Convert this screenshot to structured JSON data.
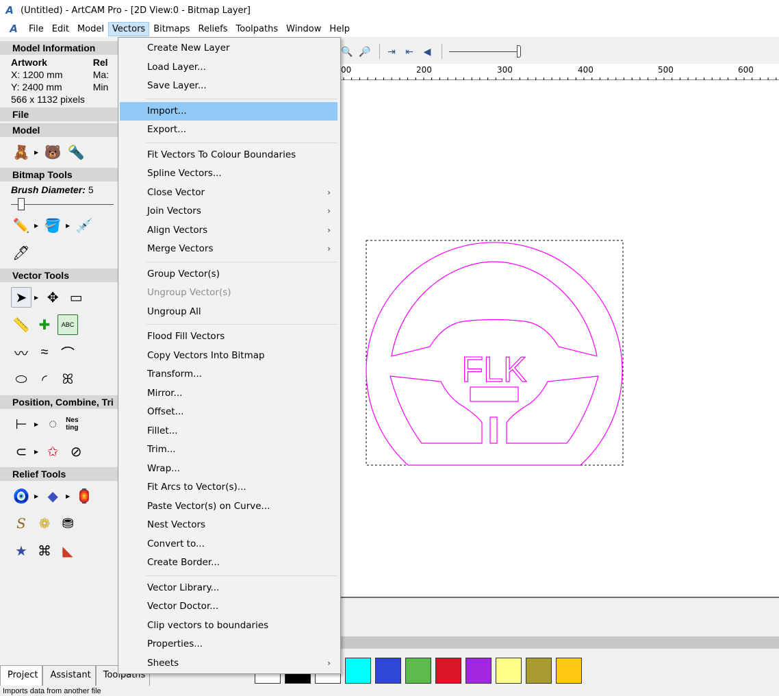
{
  "window": {
    "title": "(Untitled) - ArtCAM Pro - [2D View:0 - Bitmap Layer]",
    "logo": "A"
  },
  "menubar": [
    "File",
    "Edit",
    "Model",
    "Vectors",
    "Bitmaps",
    "Reliefs",
    "Toolpaths",
    "Window",
    "Help"
  ],
  "left_panel": {
    "model_info_header": "Model Information",
    "artwork_label": "Artwork",
    "relief_label": "Rel",
    "x_value": "X: 1200 mm",
    "y_value": "Y: 2400 mm",
    "pixels": "566 x 1132 pixels",
    "max_label": "Ma:",
    "min_label": "Min",
    "file_header": "File",
    "model_header": "Model",
    "bitmap_header": "Bitmap Tools",
    "brush_label": "Brush Diameter:",
    "brush_value": "5",
    "brush_slider_value": 0.07,
    "vector_header": "Vector Tools",
    "position_header": "Position, Combine, Tri",
    "relief_header": "Relief Tools",
    "nesting_icon_text": "Nes ting",
    "abc_icon_text": "ABC"
  },
  "vectors_menu": {
    "groups": [
      [
        {
          "label": "Create New Layer"
        },
        {
          "label": "Load Layer..."
        },
        {
          "label": "Save Layer..."
        }
      ],
      [
        {
          "label": "Import...",
          "highlighted": true
        },
        {
          "label": "Export..."
        }
      ],
      [
        {
          "label": "Fit Vectors To Colour Boundaries"
        },
        {
          "label": "Spline Vectors..."
        },
        {
          "label": "Close Vector",
          "submenu": true
        },
        {
          "label": "Join Vectors",
          "submenu": true
        },
        {
          "label": "Align Vectors",
          "submenu": true
        },
        {
          "label": "Merge Vectors",
          "submenu": true
        }
      ],
      [
        {
          "label": "Group Vector(s)"
        },
        {
          "label": "Ungroup Vector(s)",
          "disabled": true
        },
        {
          "label": "Ungroup All"
        }
      ],
      [
        {
          "label": "Flood Fill Vectors"
        },
        {
          "label": "Copy Vectors Into Bitmap"
        },
        {
          "label": "Transform..."
        },
        {
          "label": "Mirror..."
        },
        {
          "label": "Offset..."
        },
        {
          "label": "Fillet..."
        },
        {
          "label": "Trim..."
        },
        {
          "label": "Wrap..."
        },
        {
          "label": "Fit Arcs to Vector(s)..."
        },
        {
          "label": "Paste Vector(s) on Curve..."
        },
        {
          "label": "Nest Vectors"
        },
        {
          "label": "Convert to..."
        },
        {
          "label": "Create Border..."
        }
      ],
      [
        {
          "label": "Vector Library..."
        },
        {
          "label": "Vector Doctor..."
        },
        {
          "label": "Clip vectors to boundaries"
        },
        {
          "label": "Properties..."
        },
        {
          "label": "Sheets",
          "submenu": true
        }
      ]
    ]
  },
  "ruler": {
    "labels": [
      "00",
      "200",
      "300",
      "400",
      "500",
      "600"
    ]
  },
  "canvas": {
    "vector_color": "#ff00ff",
    "logo_text": "FLK"
  },
  "zoom_level": 0.95,
  "palette": [
    "#ffffff",
    "#000000",
    "#ffffff",
    "#00ffff",
    "#3046d6",
    "#5cbb4a",
    "#d81628",
    "#a128e0",
    "#ffff88",
    "#a89b30",
    "#ffc810"
  ],
  "bottom_tabs": [
    "Project",
    "Assistant",
    "Toolpaths"
  ],
  "status_text": "Imports data from another file"
}
